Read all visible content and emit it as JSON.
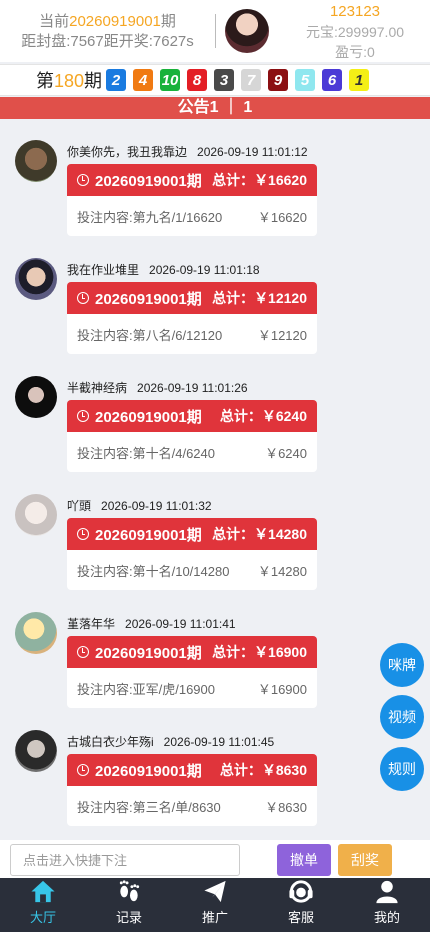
{
  "header": {
    "current_prefix": "当前",
    "current_issue": "20260919001",
    "current_suffix": "期",
    "countdown": "距封盘:7567距开奖:7627s",
    "username": "123123",
    "balance": "元宝:299997.00",
    "profit": "盈亏:0"
  },
  "draw": {
    "prefix": "第",
    "number": "180",
    "suffix": "期",
    "balls": [
      {
        "value": "2",
        "color": "#1a7be0"
      },
      {
        "value": "4",
        "color": "#f07a12"
      },
      {
        "value": "10",
        "color": "#19b23b"
      },
      {
        "value": "8",
        "color": "#e31e25"
      },
      {
        "value": "3",
        "color": "#4a4a4a"
      },
      {
        "value": "7",
        "color": "#d6d6d6"
      },
      {
        "value": "9",
        "color": "#8b0f12"
      },
      {
        "value": "5",
        "color": "#8fe7ef"
      },
      {
        "value": "6",
        "color": "#4b3ad6"
      },
      {
        "value": "1",
        "color": "#f4ef16"
      }
    ]
  },
  "notice": {
    "text": "公告1 ｜ 1"
  },
  "posts": [
    {
      "name": "你美你先，我丑我靠边",
      "time": "2026-09-19 11:01:12",
      "period": "20260919001期",
      "total_label": "总计：",
      "total": "￥16620",
      "content": "投注内容:第九名/1/16620",
      "amount": "￥16620"
    },
    {
      "name": "我在作业堆里",
      "time": "2026-09-19 11:01:18",
      "period": "20260919001期",
      "total_label": "总计：",
      "total": "￥12120",
      "content": "投注内容:第八名/6/12120",
      "amount": "￥12120"
    },
    {
      "name": "半截神经病",
      "time": "2026-09-19 11:01:26",
      "period": "20260919001期",
      "total_label": "总计：",
      "total": "￥6240",
      "content": "投注内容:第十名/4/6240",
      "amount": "￥6240"
    },
    {
      "name": "吖頭",
      "time": "2026-09-19 11:01:32",
      "period": "20260919001期",
      "total_label": "总计：",
      "total": "￥14280",
      "content": "投注内容:第十名/10/14280",
      "amount": "￥14280"
    },
    {
      "name": "堇落年华",
      "time": "2026-09-19 11:01:41",
      "period": "20260919001期",
      "total_label": "总计：",
      "total": "￥16900",
      "content": "投注内容:亚军/虎/16900",
      "amount": "￥16900"
    },
    {
      "name": "古城白衣少年殇i",
      "time": "2026-09-19 11:01:45",
      "period": "20260919001期",
      "total_label": "总计：",
      "total": "￥8630",
      "content": "投注内容:第三名/单/8630",
      "amount": "￥8630"
    }
  ],
  "floating": {
    "mipai": "咪牌",
    "video": "视频",
    "rules": "规则"
  },
  "quick": {
    "placeholder": "点击进入快捷下注",
    "cancel": "撤单",
    "scratch": "刮奖"
  },
  "nav": {
    "hall": "大厅",
    "records": "记录",
    "promote": "推广",
    "service": "客服",
    "mine": "我的"
  },
  "colors": {
    "accent": "#e0343b",
    "nav_active": "#37c6e8",
    "float": "#1890e6"
  }
}
